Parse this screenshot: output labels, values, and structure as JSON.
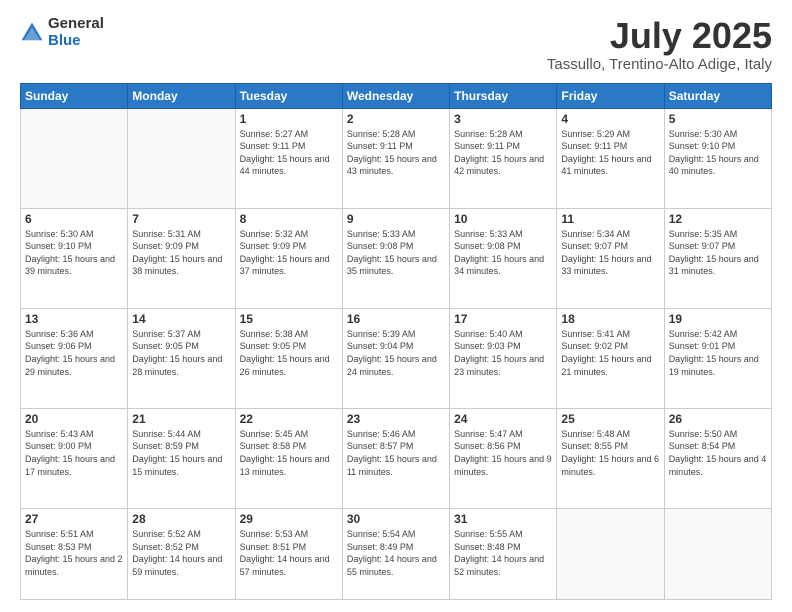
{
  "logo": {
    "general": "General",
    "blue": "Blue"
  },
  "header": {
    "title": "July 2025",
    "subtitle": "Tassullo, Trentino-Alto Adige, Italy"
  },
  "weekdays": [
    "Sunday",
    "Monday",
    "Tuesday",
    "Wednesday",
    "Thursday",
    "Friday",
    "Saturday"
  ],
  "weeks": [
    [
      {
        "day": "",
        "info": ""
      },
      {
        "day": "",
        "info": ""
      },
      {
        "day": "1",
        "info": "Sunrise: 5:27 AM\nSunset: 9:11 PM\nDaylight: 15 hours and 44 minutes."
      },
      {
        "day": "2",
        "info": "Sunrise: 5:28 AM\nSunset: 9:11 PM\nDaylight: 15 hours and 43 minutes."
      },
      {
        "day": "3",
        "info": "Sunrise: 5:28 AM\nSunset: 9:11 PM\nDaylight: 15 hours and 42 minutes."
      },
      {
        "day": "4",
        "info": "Sunrise: 5:29 AM\nSunset: 9:11 PM\nDaylight: 15 hours and 41 minutes."
      },
      {
        "day": "5",
        "info": "Sunrise: 5:30 AM\nSunset: 9:10 PM\nDaylight: 15 hours and 40 minutes."
      }
    ],
    [
      {
        "day": "6",
        "info": "Sunrise: 5:30 AM\nSunset: 9:10 PM\nDaylight: 15 hours and 39 minutes."
      },
      {
        "day": "7",
        "info": "Sunrise: 5:31 AM\nSunset: 9:09 PM\nDaylight: 15 hours and 38 minutes."
      },
      {
        "day": "8",
        "info": "Sunrise: 5:32 AM\nSunset: 9:09 PM\nDaylight: 15 hours and 37 minutes."
      },
      {
        "day": "9",
        "info": "Sunrise: 5:33 AM\nSunset: 9:08 PM\nDaylight: 15 hours and 35 minutes."
      },
      {
        "day": "10",
        "info": "Sunrise: 5:33 AM\nSunset: 9:08 PM\nDaylight: 15 hours and 34 minutes."
      },
      {
        "day": "11",
        "info": "Sunrise: 5:34 AM\nSunset: 9:07 PM\nDaylight: 15 hours and 33 minutes."
      },
      {
        "day": "12",
        "info": "Sunrise: 5:35 AM\nSunset: 9:07 PM\nDaylight: 15 hours and 31 minutes."
      }
    ],
    [
      {
        "day": "13",
        "info": "Sunrise: 5:36 AM\nSunset: 9:06 PM\nDaylight: 15 hours and 29 minutes."
      },
      {
        "day": "14",
        "info": "Sunrise: 5:37 AM\nSunset: 9:05 PM\nDaylight: 15 hours and 28 minutes."
      },
      {
        "day": "15",
        "info": "Sunrise: 5:38 AM\nSunset: 9:05 PM\nDaylight: 15 hours and 26 minutes."
      },
      {
        "day": "16",
        "info": "Sunrise: 5:39 AM\nSunset: 9:04 PM\nDaylight: 15 hours and 24 minutes."
      },
      {
        "day": "17",
        "info": "Sunrise: 5:40 AM\nSunset: 9:03 PM\nDaylight: 15 hours and 23 minutes."
      },
      {
        "day": "18",
        "info": "Sunrise: 5:41 AM\nSunset: 9:02 PM\nDaylight: 15 hours and 21 minutes."
      },
      {
        "day": "19",
        "info": "Sunrise: 5:42 AM\nSunset: 9:01 PM\nDaylight: 15 hours and 19 minutes."
      }
    ],
    [
      {
        "day": "20",
        "info": "Sunrise: 5:43 AM\nSunset: 9:00 PM\nDaylight: 15 hours and 17 minutes."
      },
      {
        "day": "21",
        "info": "Sunrise: 5:44 AM\nSunset: 8:59 PM\nDaylight: 15 hours and 15 minutes."
      },
      {
        "day": "22",
        "info": "Sunrise: 5:45 AM\nSunset: 8:58 PM\nDaylight: 15 hours and 13 minutes."
      },
      {
        "day": "23",
        "info": "Sunrise: 5:46 AM\nSunset: 8:57 PM\nDaylight: 15 hours and 11 minutes."
      },
      {
        "day": "24",
        "info": "Sunrise: 5:47 AM\nSunset: 8:56 PM\nDaylight: 15 hours and 9 minutes."
      },
      {
        "day": "25",
        "info": "Sunrise: 5:48 AM\nSunset: 8:55 PM\nDaylight: 15 hours and 6 minutes."
      },
      {
        "day": "26",
        "info": "Sunrise: 5:50 AM\nSunset: 8:54 PM\nDaylight: 15 hours and 4 minutes."
      }
    ],
    [
      {
        "day": "27",
        "info": "Sunrise: 5:51 AM\nSunset: 8:53 PM\nDaylight: 15 hours and 2 minutes."
      },
      {
        "day": "28",
        "info": "Sunrise: 5:52 AM\nSunset: 8:52 PM\nDaylight: 14 hours and 59 minutes."
      },
      {
        "day": "29",
        "info": "Sunrise: 5:53 AM\nSunset: 8:51 PM\nDaylight: 14 hours and 57 minutes."
      },
      {
        "day": "30",
        "info": "Sunrise: 5:54 AM\nSunset: 8:49 PM\nDaylight: 14 hours and 55 minutes."
      },
      {
        "day": "31",
        "info": "Sunrise: 5:55 AM\nSunset: 8:48 PM\nDaylight: 14 hours and 52 minutes."
      },
      {
        "day": "",
        "info": ""
      },
      {
        "day": "",
        "info": ""
      }
    ]
  ]
}
